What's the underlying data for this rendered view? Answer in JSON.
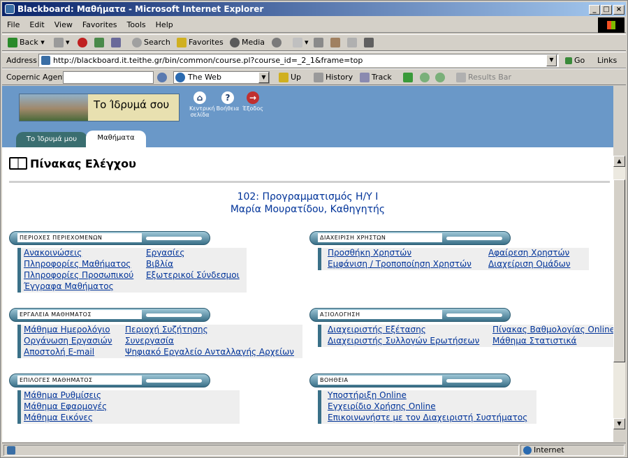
{
  "window": {
    "title": "Blackboard: Μαθήματα - Microsoft Internet Explorer"
  },
  "menu": [
    "File",
    "Edit",
    "View",
    "Favorites",
    "Tools",
    "Help"
  ],
  "toolbar": {
    "back": "Back",
    "search": "Search",
    "favorites": "Favorites",
    "media": "Media"
  },
  "address": {
    "label": "Address",
    "url": "http://blackboard.it.teithe.gr/bin/common/course.pl?course_id=_2_1&frame=top",
    "go": "Go",
    "links": "Links"
  },
  "copernic": {
    "label": "Copernic Agent",
    "engine": "The Web",
    "up": "Up",
    "history": "History",
    "track": "Track",
    "results": "Results Bar"
  },
  "header": {
    "logo_text": "Το Ίδρυμά σου",
    "home_label": "Κεντρική σελίδα",
    "help_label": "Βοήθεια",
    "exit_label": "Έξοδος"
  },
  "tabs": [
    "Το Ίδρυμά μου",
    "Μαθήματα"
  ],
  "page": {
    "title": "Πίνακας Ελέγχου",
    "course_title": "102:  Προγραμματισμός Η/Υ Ι",
    "instructor": "Μαρία Μουρατίδου, Καθηγητής"
  },
  "sections": [
    {
      "title": "ΠΕΡΙΟΧΕΣ ΠΕΡΙΕΧΟΜΕΝΩΝ",
      "links": [
        "Ανακοινώσεις",
        "Εργασίες",
        "Πληροφορίες Μαθήματος",
        "Βιβλία",
        "Πληροφορίες Προσωπικού",
        "Εξωτερικοί Σύνδεσμοι",
        "Έγγραφα Μαθήματος"
      ]
    },
    {
      "title": "ΔΙΑΧΕΙΡΙΣΗ ΧΡΗΣΤΩΝ",
      "links": [
        "Προσθήκη Χρηστών",
        "Αφαίρεση Χρηστών",
        "Εμφάνιση / Τροποποίηση Χρηστών",
        "Διαχείριση Ομάδων"
      ]
    },
    {
      "title": "ΕΡΓΑΛΕΙΑ ΜΑΘΗΜΑΤΟΣ",
      "links": [
        "Μάθημα Ημερολόγιο",
        "Περιοχή Συζήτησης",
        "Οργάνωση Εργασιών",
        "Συνεργασία",
        "Αποστολή E-mail",
        "Ψηφιακό Εργαλείο Ανταλλαγής Αρχείων"
      ]
    },
    {
      "title": "ΑΞΙΟΛΟΓΗΣΗ",
      "links": [
        "Διαχειριστής Εξέτασης",
        "Πίνακας Βαθμολογίας Online",
        "Διαχειριστής Συλλογών Ερωτήσεων",
        "Μάθημα Στατιστικά"
      ]
    },
    {
      "title": "ΕΠΙΛΟΓΕΣ ΜΑΘΗΜΑΤΟΣ",
      "links": [
        "Μάθημα Ρυθμίσεις",
        "Μάθημα Εφαρμογές",
        "Μάθημα Εικόνες"
      ]
    },
    {
      "title": "ΒΟΗΘΕΙΑ",
      "links": [
        "Υποστήριξη Online",
        "Εγχειρίδιο Χρήσης Online",
        "Επικοινωνήστε με τον Διαχειριστή Συστήματος"
      ]
    }
  ],
  "status": {
    "zone": "Internet"
  }
}
